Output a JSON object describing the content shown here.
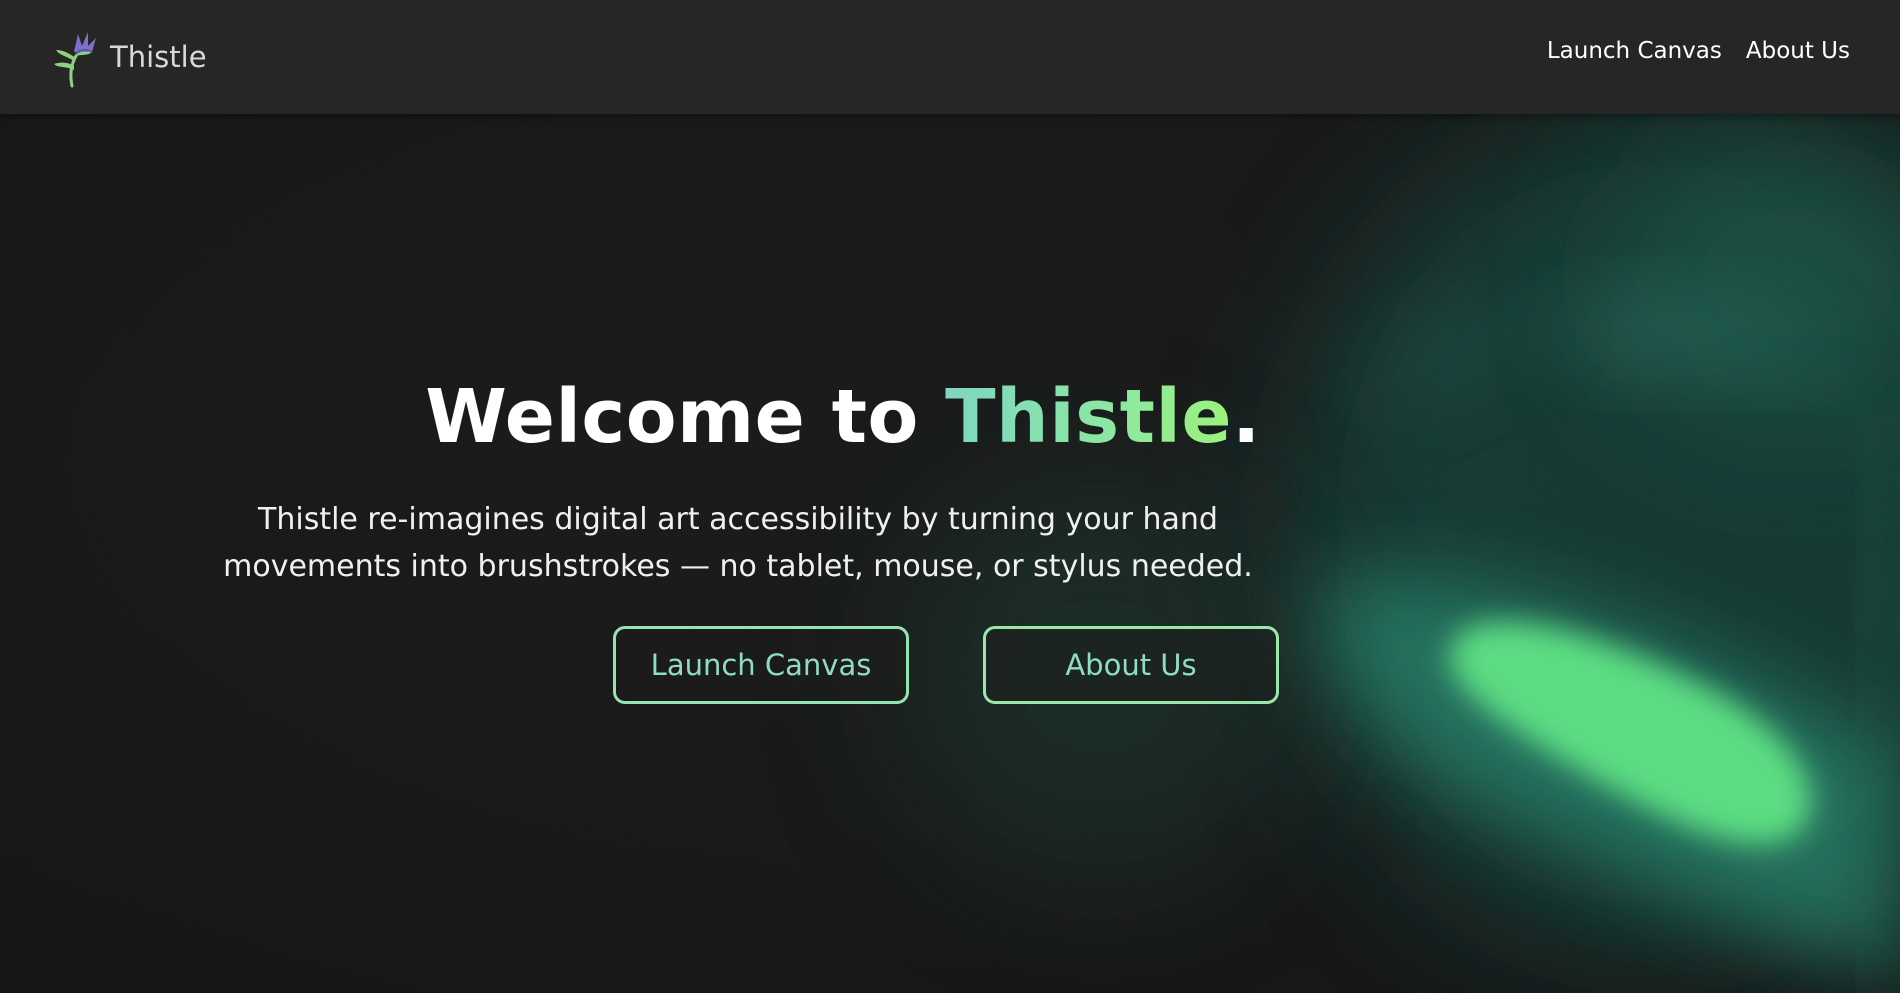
{
  "navbar": {
    "brand_name": "Thistle",
    "logo_icon": "thistle-flower-icon",
    "links": [
      {
        "label": "Launch Canvas"
      },
      {
        "label": "About Us"
      }
    ]
  },
  "hero": {
    "title_prefix": "Welcome to ",
    "title_accent": "Thistle",
    "title_suffix": ".",
    "description": "Thistle re-imagines digital art accessibility by turning your hand movements into brushstrokes — no tablet, mouse, or stylus needed.",
    "buttons": [
      {
        "label": "Launch Canvas"
      },
      {
        "label": "About Us"
      }
    ]
  },
  "colors": {
    "navbar_bg": "#262626",
    "page_bg": "#1b1b1b",
    "accent_teal": "#7fd6c2",
    "accent_green": "#9cf27a",
    "glow_green": "#5cdc82",
    "glow_teal": "#2f8a78"
  }
}
